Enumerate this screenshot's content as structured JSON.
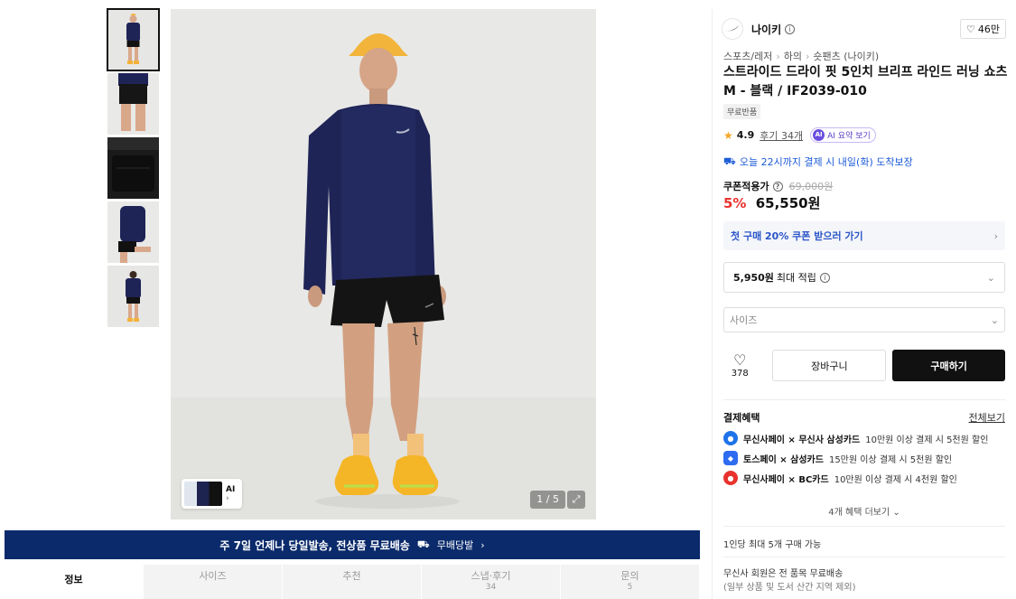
{
  "gallery": {
    "thumbnails": [
      "thumb-1",
      "thumb-2",
      "thumb-3",
      "thumb-4",
      "thumb-5"
    ],
    "ai_tag": "AI",
    "counter": "1 / 5",
    "expand_icon": "expand-icon"
  },
  "shipping_banner": {
    "text": "주 7일 언제나 당일발송, 전상품 무료배송",
    "badge": "무배당발",
    "chevron": "›"
  },
  "tabs": [
    {
      "label": "정보",
      "count": ""
    },
    {
      "label": "사이즈",
      "count": ""
    },
    {
      "label": "추천",
      "count": ""
    },
    {
      "label": "스냅·후기",
      "count": "34"
    },
    {
      "label": "문의",
      "count": "5"
    }
  ],
  "brand": {
    "name": "나이키",
    "likes": "46만"
  },
  "breadcrumbs": [
    "스포츠/레저",
    "하의",
    "숏팬츠 (나이키)"
  ],
  "product": {
    "title": "스트라이드 드라이 핏 5인치 브리프 라인드 러닝 쇼츠 M - 블랙 / IF2039-010",
    "tag": "무료반품",
    "rating": "4.9",
    "reviews": "후기 34개",
    "ai_summary": "AI 요약 보기",
    "ai_badge": "AI",
    "delivery": "오늘 22시까지 결제 시 내일(화) 도착보장"
  },
  "price": {
    "label": "쿠폰적용가",
    "original": "69,000원",
    "discount": "5%",
    "final": "65,550원"
  },
  "coupon": {
    "text": "첫 구매 20% 쿠폰 받으러 가기",
    "chevron": "›"
  },
  "points": {
    "amount": "5,950원",
    "text": "최대 적립"
  },
  "size_select": {
    "placeholder": "사이즈"
  },
  "actions": {
    "wish_count": "378",
    "cart": "장바구니",
    "buy": "구매하기"
  },
  "payment": {
    "title": "결제혜택",
    "view_all": "전체보기",
    "items": [
      {
        "brand": "무신사페이 × 무신사 삼성카드",
        "detail": "10만원 이상 결제 시 5천원 할인",
        "color": "#1e73e8",
        "icon": "musinsa-pay-icon"
      },
      {
        "brand": "토스페이 × 삼성카드",
        "detail": "15만원 이상 결제 시 5천원 할인",
        "color": "#2d6cf0",
        "icon": "toss-pay-icon"
      },
      {
        "brand": "무신사페이 × BC카드",
        "detail": "10만원 이상 결제 시 4천원 할인",
        "color": "#e8322d",
        "icon": "bc-card-icon"
      }
    ],
    "more": "4개 혜택 더보기"
  },
  "limit": "1인당 최대 5개 구매 가능",
  "member_shipping": {
    "line1": "무신사 회원은 전 품목 무료배송",
    "line2": "(일부 상품 및 도서 산간 지역 제외)"
  }
}
